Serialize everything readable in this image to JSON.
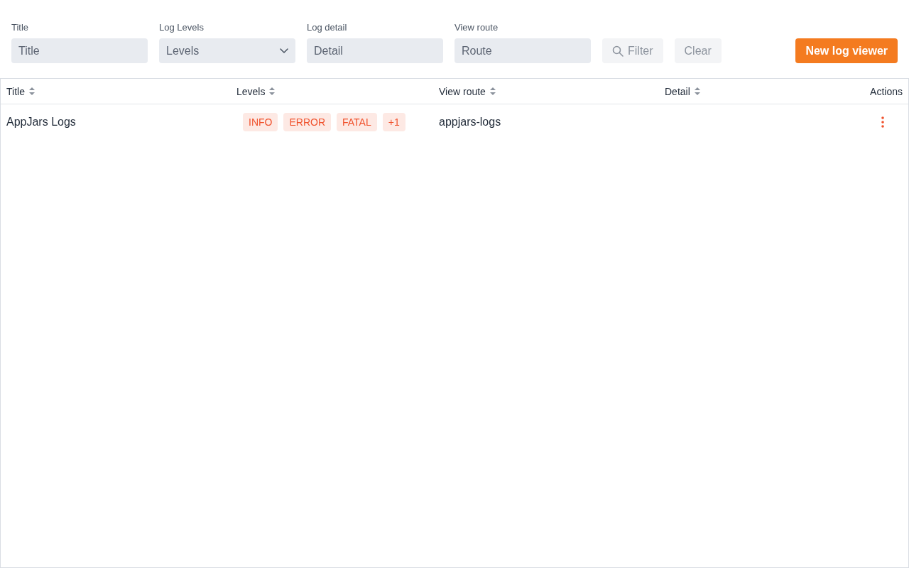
{
  "filters": [
    {
      "kind": "input",
      "label": "Title",
      "placeholder": "Title"
    },
    {
      "kind": "select",
      "label": "Log Levels",
      "placeholder": "Levels"
    },
    {
      "kind": "input",
      "label": "Log detail",
      "placeholder": "Detail"
    },
    {
      "kind": "input",
      "label": "View route",
      "placeholder": "Route"
    }
  ],
  "buttons": [
    {
      "kind": "filter",
      "label": "Filter",
      "disabled": true
    },
    {
      "kind": "clear",
      "label": "Clear",
      "disabled": true
    }
  ],
  "primary_button": {
    "label": "New log viewer"
  },
  "table": {
    "columns": [
      {
        "label": "Title",
        "sortable": true
      },
      {
        "label": "Levels",
        "sortable": true
      },
      {
        "label": "View route",
        "sortable": true
      },
      {
        "label": "Detail",
        "sortable": true
      },
      {
        "label": "Actions",
        "sortable": false
      }
    ],
    "rows": [
      {
        "title": "AppJars Logs",
        "levels": [
          "INFO",
          "ERROR",
          "FATAL"
        ],
        "more": "+1",
        "view_route": "appjars-logs"
      }
    ]
  }
}
